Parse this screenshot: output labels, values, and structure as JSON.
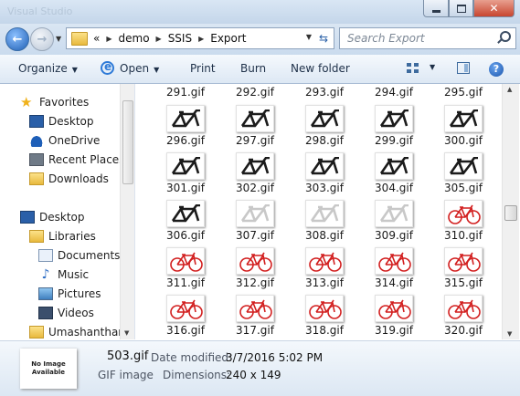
{
  "window": {
    "title": "Visual Studio"
  },
  "address": {
    "overflow": "«",
    "crumbs": [
      "demo",
      "SSIS",
      "Export"
    ]
  },
  "search": {
    "placeholder": "Search Export"
  },
  "toolbar": {
    "organize": "Organize",
    "open": "Open",
    "print": "Print",
    "burn": "Burn",
    "new_folder": "New folder"
  },
  "nav": {
    "favorites": "Favorites",
    "items": [
      "Desktop",
      "OneDrive",
      "Recent Places",
      "Downloads"
    ],
    "desktop": "Desktop",
    "libraries": "Libraries",
    "lib_items": [
      "Documents",
      "Music",
      "Pictures",
      "Videos"
    ],
    "user": "Umashanthan"
  },
  "files": {
    "top_row": [
      "291.gif",
      "292.gif",
      "293.gif",
      "294.gif",
      "295.gif"
    ],
    "rows": [
      [
        "296.gif",
        "297.gif",
        "298.gif",
        "299.gif",
        "300.gif"
      ],
      [
        "301.gif",
        "302.gif",
        "303.gif",
        "304.gif",
        "305.gif"
      ],
      [
        "306.gif",
        "307.gif",
        "308.gif",
        "309.gif",
        "310.gif"
      ],
      [
        "311.gif",
        "312.gif",
        "313.gif",
        "314.gif",
        "315.gif"
      ],
      [
        "316.gif",
        "317.gif",
        "318.gif",
        "319.gif",
        "320.gif"
      ]
    ],
    "thumb_styles": [
      [
        "frame",
        "frame",
        "frame",
        "frame",
        "frame"
      ],
      [
        "frame",
        "frame",
        "frame",
        "frame",
        "frame"
      ],
      [
        "frame",
        "pale",
        "pale",
        "pale",
        "red"
      ],
      [
        "red",
        "red",
        "red",
        "red",
        "red"
      ],
      [
        "red",
        "red",
        "red",
        "red",
        "red"
      ]
    ]
  },
  "details": {
    "no_image": "No Image Available",
    "filename": "503.gif",
    "type": "GIF image",
    "date_label": "Date modified:",
    "date_value": "3/7/2016 5:02 PM",
    "dim_label": "Dimensions:",
    "dim_value": "240 x 149"
  },
  "colors": {
    "frame": "#1b1b1b",
    "pale": "#c8c8c8",
    "red": "#d21f1f"
  }
}
